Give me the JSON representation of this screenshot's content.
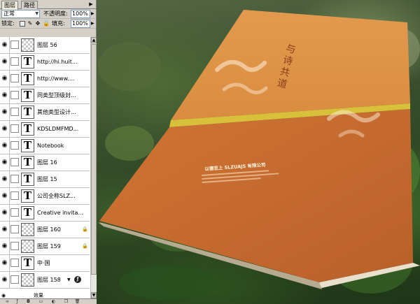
{
  "panel": {
    "tabs": [
      {
        "label": "图层",
        "active": true
      },
      {
        "label": "路径",
        "active": false
      }
    ],
    "menu_icon": "panel-menu-arrow-icon",
    "blend_mode": "正常",
    "opacity_label": "不透明度:",
    "opacity_value": "100%",
    "lock_label": "锁定:",
    "fill_label": "填充:",
    "fill_value": "100%"
  },
  "layers": [
    {
      "name": "图层 56",
      "type": "pixel",
      "visible": true
    },
    {
      "name": "http://hi.huit...",
      "type": "text",
      "visible": true
    },
    {
      "name": "http://www....",
      "type": "text",
      "visible": true
    },
    {
      "name": "同类型顶级封...",
      "type": "text",
      "visible": true
    },
    {
      "name": "其他类型设计...",
      "type": "text",
      "visible": true
    },
    {
      "name": "KDSLDMFMD...",
      "type": "text",
      "visible": true
    },
    {
      "name": "Notebook",
      "type": "text",
      "visible": true
    },
    {
      "name": "图层 16",
      "type": "text",
      "visible": true
    },
    {
      "name": "图层 15",
      "type": "text",
      "visible": true
    },
    {
      "name": "公司全称SLZ...",
      "type": "text",
      "visible": true
    },
    {
      "name": "Creative invita...",
      "type": "text",
      "visible": true
    },
    {
      "name": "图层 160",
      "type": "pixel",
      "visible": true,
      "locked": true
    },
    {
      "name": "图层 159",
      "type": "pixel",
      "visible": true,
      "locked": true
    },
    {
      "name": "中·国",
      "type": "text",
      "visible": true
    },
    {
      "name": "图层 158",
      "type": "pixel",
      "visible": true,
      "has_effects": true
    }
  ],
  "effects_label": "效果",
  "book": {
    "title": "与诗共道",
    "company": "以德至上 SLZUAJS 有限公司",
    "colors": {
      "cover_top": "#e09548",
      "cover_bottom": "#c86a2a",
      "band": "#d9c03a",
      "title": "#8a3c1c"
    }
  },
  "bottom_bar_icons": [
    "link-layers-icon",
    "layer-style-icon",
    "mask-icon",
    "new-set-icon",
    "adjustment-layer-icon",
    "new-layer-icon",
    "trash-icon"
  ]
}
